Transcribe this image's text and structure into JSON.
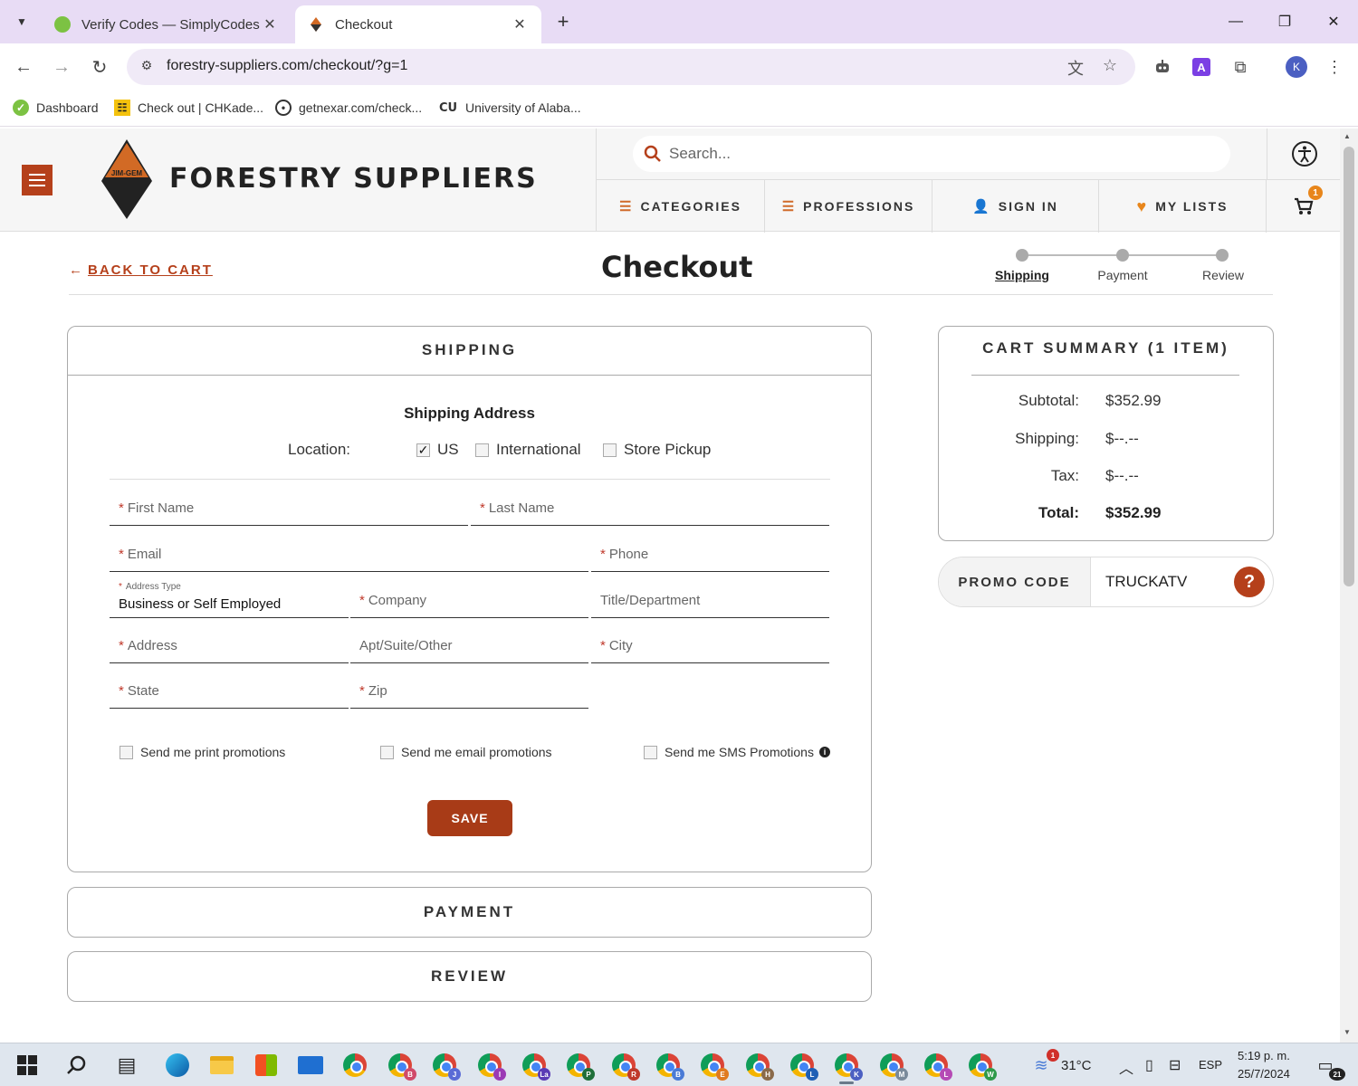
{
  "browser": {
    "tabs": [
      {
        "title": "Verify Codes — SimplyCodes",
        "favicon": "simplycodes-favicon"
      },
      {
        "title": "Checkout",
        "favicon": "forestry-suppliers-favicon"
      }
    ],
    "url": "forestry-suppliers.com/checkout/?g=1",
    "profile_initial": "K",
    "bookmarks": [
      {
        "label": "Dashboard"
      },
      {
        "label": "Check out | CHKade..."
      },
      {
        "label": "getnexar.com/check..."
      },
      {
        "label": "University of Alaba..."
      }
    ]
  },
  "site": {
    "brand": "FORESTRY SUPPLIERS",
    "logo_text": "JIM-GEM",
    "search_placeholder": "Search...",
    "menu": {
      "categories": "CATEGORIES",
      "professions": "PROFESSIONS",
      "sign_in": "SIGN IN",
      "my_lists": "MY LISTS"
    },
    "cart_count": "1",
    "accent_color": "#b5401b"
  },
  "checkout": {
    "back_label": "BACK TO CART",
    "title": "Checkout",
    "steps": [
      "Shipping",
      "Payment",
      "Review"
    ],
    "active_step": "Shipping"
  },
  "shipping": {
    "heading": "SHIPPING",
    "subheading": "Shipping Address",
    "location_label": "Location:",
    "location_options": [
      {
        "label": "US",
        "checked": true
      },
      {
        "label": "International",
        "checked": false
      },
      {
        "label": "Store Pickup",
        "checked": false
      }
    ],
    "fields": {
      "first_name": "First Name",
      "last_name": "Last Name",
      "email": "Email",
      "phone": "Phone",
      "address_type_label": "Address Type",
      "address_type_value": "Business or Self Employed",
      "company": "Company",
      "title_department": "Title/Department",
      "address": "Address",
      "apt": "Apt/Suite/Other",
      "city": "City",
      "state": "State",
      "zip": "Zip"
    },
    "promotions": {
      "print": "Send me print promotions",
      "email": "Send me email promotions",
      "sms": "Send me SMS Promotions"
    },
    "save_label": "SAVE"
  },
  "payment": {
    "heading": "PAYMENT"
  },
  "review": {
    "heading": "REVIEW"
  },
  "cart_summary": {
    "heading": "CART SUMMARY (1 ITEM)",
    "rows": [
      {
        "label": "Subtotal:",
        "value": "$352.99"
      },
      {
        "label": "Shipping:",
        "value": "$--.--"
      },
      {
        "label": "Tax:",
        "value": "$--.--"
      },
      {
        "label": "Total:",
        "value": "$352.99"
      }
    ]
  },
  "promo": {
    "label": "PROMO CODE",
    "value": "TRUCKATV",
    "help": "?"
  },
  "taskbar": {
    "apps": [
      "windows-start",
      "search",
      "task-view",
      "edge",
      "file-explorer",
      "microsoft-store",
      "mail",
      "chrome"
    ],
    "chrome_profiles": [
      "B",
      "J",
      "I",
      "La",
      "P",
      "R",
      "B",
      "E",
      "H",
      "L",
      "K",
      "M",
      "L",
      "W"
    ],
    "weather_temp": "31°C",
    "weather_alert": "1",
    "language": "ESP",
    "time": "5:19 p. m.",
    "date": "25/7/2024",
    "notifications": "21"
  }
}
